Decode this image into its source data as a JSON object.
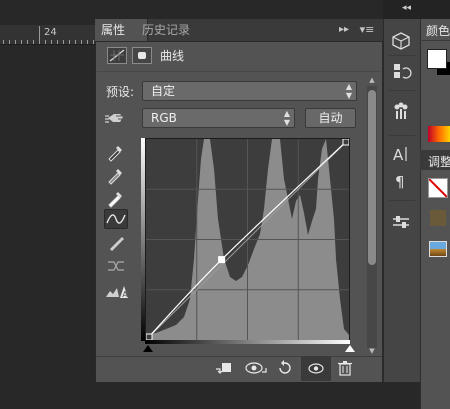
{
  "ruler": {
    "label": "24"
  },
  "tabs": [
    {
      "label": "属性"
    },
    {
      "label": "历史记录"
    }
  ],
  "panel_menu": {
    "collapse_glyph": "▸▸",
    "menu_glyph": "▾≡"
  },
  "header": {
    "title": "曲线",
    "icons": [
      "curves-adjustment-icon",
      "layer-mask-icon"
    ]
  },
  "preset": {
    "label": "预设:",
    "value": "自定"
  },
  "channel": {
    "value": "RGB",
    "auto_label": "自动"
  },
  "tools": [
    "on-image-adjust-icon",
    "black-point-eyedropper-icon",
    "gray-point-eyedropper-icon",
    "white-point-eyedropper-icon",
    "curve-edit-points-icon",
    "pencil-draw-icon",
    "smooth-curve-icon",
    "clipping-warning-icon"
  ],
  "curve": {
    "control_points": [
      [
        0,
        0
      ],
      [
        95,
        102
      ],
      [
        255,
        255
      ]
    ],
    "input_range": [
      0,
      255
    ],
    "output_range": [
      0,
      255
    ],
    "grid_divisions": 4
  },
  "footer_icons": [
    "clip-to-layer-icon",
    "view-previous-state-icon",
    "reset-icon",
    "visibility-eye-icon",
    "delete-trash-icon"
  ],
  "right_dock": {
    "tabs": [
      {
        "label": "颜色"
      },
      {
        "label": "调整"
      }
    ],
    "strip_icons": [
      "3d-icon",
      "history-brush-icon",
      "brushes-icon",
      "character-icon",
      "paragraph-icon",
      "tool-presets-icon"
    ]
  },
  "colors": {
    "panel_bg": "#535353",
    "graph_bg": "#3d3d3d",
    "histogram": "#8c8c8c",
    "curve": "#ffffff"
  }
}
